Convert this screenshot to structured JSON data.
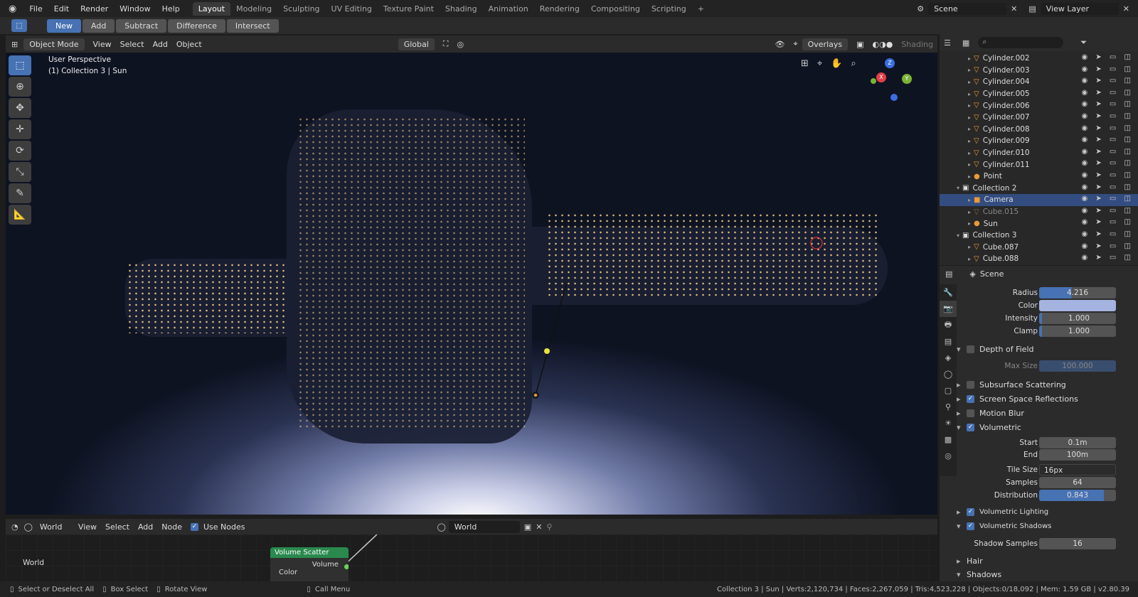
{
  "menu": [
    "File",
    "Edit",
    "Render",
    "Window",
    "Help"
  ],
  "workspaces": [
    "Layout",
    "Modeling",
    "Sculpting",
    "UV Editing",
    "Texture Paint",
    "Shading",
    "Animation",
    "Rendering",
    "Compositing",
    "Scripting"
  ],
  "active_workspace": "Layout",
  "scene_name": "Scene",
  "view_layer": "View Layer",
  "boolean_buttons": [
    "New",
    "Add",
    "Subtract",
    "Difference",
    "Intersect"
  ],
  "viewport": {
    "mode": "Object Mode",
    "menus": [
      "View",
      "Select",
      "Add",
      "Object"
    ],
    "transform": "Global",
    "overlays": "Overlays",
    "shading": "Shading",
    "perspective_label": "User Perspective",
    "context_label": "(1) Collection 3 | Sun",
    "gizmo": {
      "z": "Z",
      "x": "X",
      "y": "Y"
    }
  },
  "outliner": [
    {
      "name": "Cylinder.002",
      "kind": "mesh",
      "indent": 2
    },
    {
      "name": "Cylinder.003",
      "kind": "mesh",
      "indent": 2
    },
    {
      "name": "Cylinder.004",
      "kind": "mesh",
      "indent": 2
    },
    {
      "name": "Cylinder.005",
      "kind": "mesh",
      "indent": 2
    },
    {
      "name": "Cylinder.006",
      "kind": "mesh",
      "indent": 2
    },
    {
      "name": "Cylinder.007",
      "kind": "mesh",
      "indent": 2
    },
    {
      "name": "Cylinder.008",
      "kind": "mesh",
      "indent": 2
    },
    {
      "name": "Cylinder.009",
      "kind": "mesh",
      "indent": 2
    },
    {
      "name": "Cylinder.010",
      "kind": "mesh",
      "indent": 2
    },
    {
      "name": "Cylinder.011",
      "kind": "mesh",
      "indent": 2
    },
    {
      "name": "Point",
      "kind": "light",
      "indent": 2
    },
    {
      "name": "Collection 2",
      "kind": "collection",
      "indent": 1
    },
    {
      "name": "Camera",
      "kind": "camera",
      "indent": 2
    },
    {
      "name": "Cube.015",
      "kind": "mesh-dim",
      "indent": 2
    },
    {
      "name": "Sun",
      "kind": "light",
      "indent": 2
    },
    {
      "name": "Collection 3",
      "kind": "collection",
      "indent": 1
    },
    {
      "name": "Cube.087",
      "kind": "mesh",
      "indent": 2
    },
    {
      "name": "Cube.088",
      "kind": "mesh",
      "indent": 2
    }
  ],
  "outliner_selected": 12,
  "props": {
    "context": "Scene",
    "radius": {
      "label": "Radius",
      "value": "4.216",
      "fill": 0.42
    },
    "color": {
      "label": "Color",
      "swatch": "#a5b3e0"
    },
    "intensity": {
      "label": "Intensity",
      "value": "1.000"
    },
    "clamp": {
      "label": "Clamp",
      "value": "1.000"
    },
    "dof": "Depth of Field",
    "max_size": {
      "label": "Max Size",
      "value": "100.000"
    },
    "sss": "Subsurface Scattering",
    "ssr": "Screen Space Reflections",
    "motion_blur": "Motion Blur",
    "volumetric": "Volumetric",
    "start": {
      "label": "Start",
      "value": "0.1m"
    },
    "end": {
      "label": "End",
      "value": "100m"
    },
    "tile_size": {
      "label": "Tile Size",
      "value": "16px"
    },
    "samples": {
      "label": "Samples",
      "value": "64"
    },
    "distribution": {
      "label": "Distribution",
      "value": "0.843",
      "fill": 0.843
    },
    "vol_lighting": "Volumetric Lighting",
    "vol_shadows": "Volumetric Shadows",
    "shadow_samples": {
      "label": "Shadow Samples",
      "value": "16"
    },
    "hair": "Hair",
    "shadows": "Shadows"
  },
  "node_editor": {
    "type": "World",
    "menus": [
      "View",
      "Select",
      "Add",
      "Node"
    ],
    "use_nodes": "Use Nodes",
    "world_field": "World",
    "area_label": "World",
    "node_title": "Volume Scatter",
    "node_output": "Volume",
    "node_input": "Color"
  },
  "status": {
    "select": "Select or Deselect All",
    "box": "Box Select",
    "rotate": "Rotate View",
    "menu": "Call Menu",
    "stats": "Collection 3 | Sun | Verts:2,120,734 | Faces:2,267,059 | Tris:4,523,228 | Objects:0/18,092 | Mem: 1.59 GB | v2.80.39"
  }
}
